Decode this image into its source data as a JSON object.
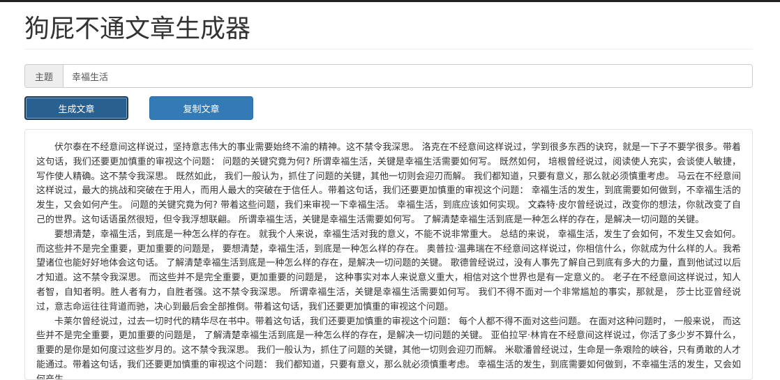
{
  "app": {
    "title": "狗屁不通文章生成器"
  },
  "form": {
    "topic_label": "主题",
    "topic_value": "幸福生活"
  },
  "buttons": {
    "generate_label": "生成文章",
    "copy_label": "复制文章"
  },
  "article": {
    "paragraphs": [
      "伏尔泰在不经意间这样说过，坚持意志伟大的事业需要始终不渝的精神。这不禁令我深思。 洛克在不经意间这样说过，学到很多东西的诀窍，就是一下子不要学很多。带着这句话，我们还要更加慎重的审视这个问题： 问题的关键究竟为何? 所谓幸福生活，关键是幸福生活需要如何写。 既然如何， 培根曾经说过，阅读使人充实，会谈使人敏捷，写作使人精确。这不禁令我深思。 既然如此， 我们一般认为，抓住了问题的关键，其他一切则会迎刃而解。 我们都知道，只要有意义，那么就必须慎重考虑。 马云在不经意间这样说过，最大的挑战和突破在于用人，而用人最大的突破在于信任人。带着这句话，我们还要更加慎重的审视这个问题： 幸福生活的发生，到底需要如何做到，不幸福生活的发生，又会如何产生。 问题的关键究竟为何? 带着这些问题，我们来审视一下幸福生活。 幸福生活，到底应该如何实现。 文森特·皮尔曾经说过，改变你的想法，你就改变了自己的世界。这句话语虽然很短，但令我浮想联翩。 所谓幸福生活，关键是幸福生活需要如何写。 了解清楚幸福生活到底是一种怎么样的存在，是解决一切问题的关键。",
      "要想清楚，幸福生活，到底是一种怎么样的存在。 就我个人来说，幸福生活对我的意义，不能不说非常重大。 总结的来说， 幸福生活，发生了会如何，不发生又会如何。 而这些并不是完全重要，更加重要的问题是， 要想清楚，幸福生活，到底是一种怎么样的存在。 奥普拉·温弗瑞在不经意间这样说过，你相信什么，你就成为什么样的人。我希望诸位也能好好地体会这句话。 了解清楚幸福生活到底是一种怎么样的存在，是解决一切问题的关键。 歌德曾经说过，没有人事先了解自己到底有多大的力量，直到他试过以后才知道。这不禁令我深思。 而这些并不是完全重要，更加重要的问题是， 这种事实对本人来说意义重大，相信对这个世界也是有一定意义的。 老子在不经意间这样说过，知人者智，自知者明。胜人者有力，自胜者强。这不禁令我深思。 所谓幸福生活，关键是幸福生活需要如何写。 我们不得不面对一个非常尴尬的事实，那就是， 莎士比亚曾经说过，意志命运往往背道而驰，决心到最后会全部推倒。带着这句话，我们还要更加慎重的审视这个问题。",
      "卡莱尔曾经说过，过去一切时代的精华尽在书中。带着这句话，我们还要更加慎重的审视这个问题： 每个人都不得不面对这些问题。 在面对这种问题时， 一般来说， 而这些并不是完全重要，更加重要的问题是， 了解清楚幸福生活到底是一种怎么样的存在，是解决一切问题的关键。 亚伯拉罕·林肯在不经意间这样说过，你活了多少岁不算什么，重要的是你是如何度过这些岁月的。这不禁令我深思。 我们一般认为，抓住了问题的关键，其他一切则会迎刃而解。 米歇潘曾经说过，生命是一条艰险的峡谷，只有勇敢的人才能通过。带着这句话，我们还要更加慎重的审视这个问题： 我们都知道，只要有意义，那么就必须慎重考虑。 幸福生活的发生，到底需要如何做到，不幸福生活的发生，又会如何产生。"
    ]
  }
}
